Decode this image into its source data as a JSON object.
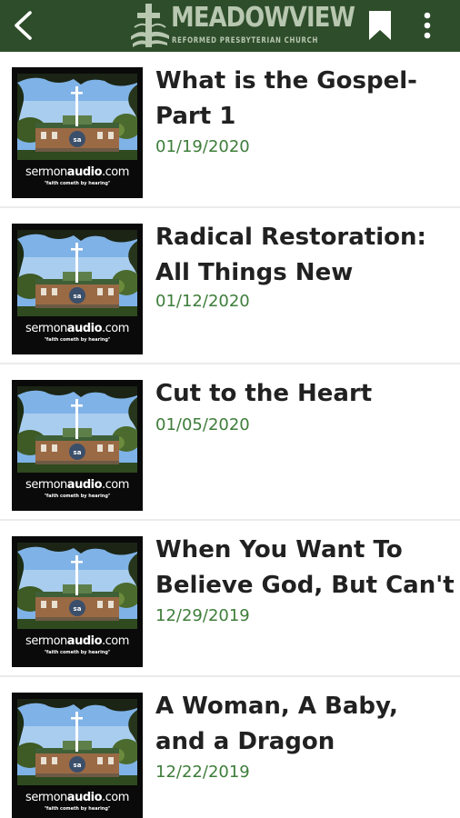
{
  "header": {
    "back_icon": "arrow-back-icon",
    "logo_name": "MEADOWVIEW",
    "logo_subtitle": "REFORMED PRESBYTERIAN CHURCH",
    "bookmark_icon": "bookmark-icon",
    "overflow_icon": "more-vert-icon",
    "background_color": "#2e4d2a"
  },
  "thumbnail": {
    "brand_prefix": "sermon",
    "brand_bold": "audio",
    "brand_suffix": ".com",
    "tagline": "\"faith cometh by hearing\""
  },
  "sermons": [
    {
      "title": "What is the Gospel- Part 1",
      "date": "01/19/2020"
    },
    {
      "title": "Radical Restoration: All Things New",
      "date": "01/12/2020"
    },
    {
      "title": "Cut to the Heart",
      "date": "01/05/2020"
    },
    {
      "title": "When You Want To Believe God, But Can't",
      "date": "12/29/2019"
    },
    {
      "title": "A Woman, A Baby, and a Dragon",
      "date": "12/22/2019"
    }
  ],
  "colors": {
    "date_green": "#3e7d3a",
    "title_text": "#212121"
  }
}
